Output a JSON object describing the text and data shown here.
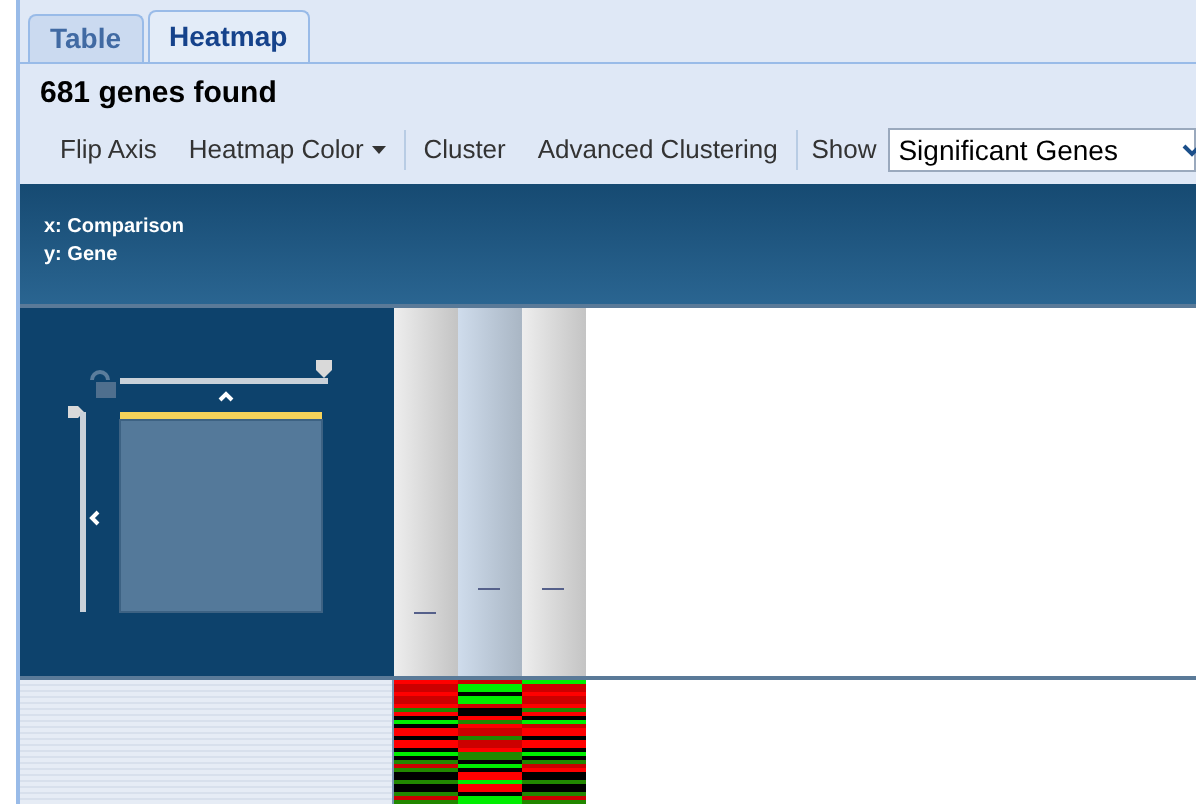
{
  "tabs": [
    {
      "label": "Table",
      "selected": false
    },
    {
      "label": "Heatmap",
      "selected": true
    }
  ],
  "title": "681 genes found",
  "toolbar": [
    {
      "kind": "button",
      "label": "Flip Axis"
    },
    {
      "kind": "menu",
      "label": "Heatmap Color"
    },
    {
      "kind": "separator"
    },
    {
      "kind": "button",
      "label": "Cluster"
    },
    {
      "kind": "button",
      "label": "Advanced Clustering"
    },
    {
      "kind": "separator"
    },
    {
      "kind": "label",
      "label": "Show"
    },
    {
      "kind": "select",
      "label": "Significant Genes"
    }
  ],
  "axes": {
    "x": "x: Comparison",
    "y": "y: Gene"
  },
  "columns": [
    {
      "selected": false
    },
    {
      "selected": true
    },
    {
      "selected": false
    }
  ]
}
